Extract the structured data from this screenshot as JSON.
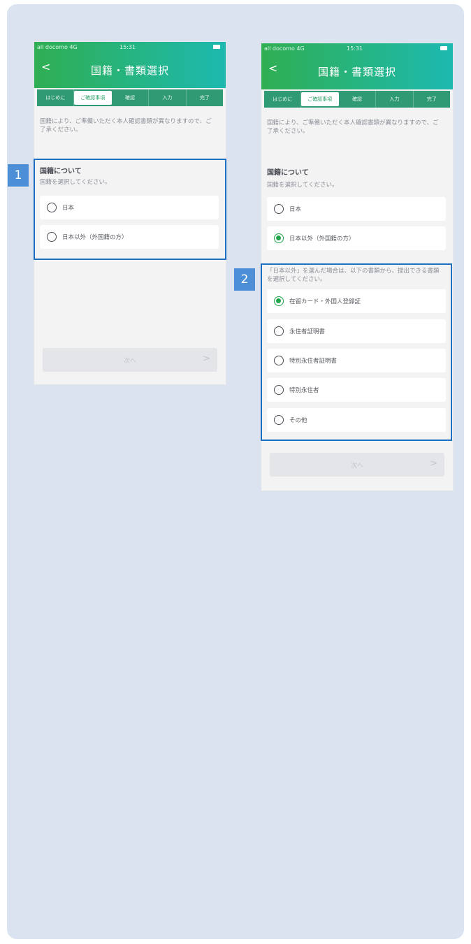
{
  "badges": [
    "1",
    "2"
  ],
  "screenA": {
    "status": {
      "carrier": "all docomo 4G",
      "time": "15:31"
    },
    "title": "国籍・書類選択",
    "back": "<",
    "steps": [
      "はじめに",
      "ご確認事項",
      "確認",
      "入力",
      "完了"
    ],
    "active_step": 1,
    "intro": "国籍により、ご準備いただく本人確認書類が異なりますので、ご了承ください。",
    "section_title": "国籍について",
    "section_sub": "国籍を選択してください。",
    "options": [
      "日本",
      "日本以外（外国籍の方）"
    ],
    "next": "次へ",
    "arrow": ">"
  },
  "screenB": {
    "status": {
      "carrier": "all docomo 4G",
      "time": "15:31"
    },
    "title": "国籍・書類選択",
    "back": "<",
    "steps": [
      "はじめに",
      "ご確認事項",
      "確認",
      "入力",
      "完了"
    ],
    "active_step": 1,
    "intro": "国籍により、ご準備いただく本人確認書類が異なりますので、ご了承ください。",
    "section_title": "国籍について",
    "section_sub": "国籍を選択してください。",
    "options": [
      "日本",
      "日本以外（外国籍の方）"
    ],
    "selected_option": 1,
    "note": "「日本以外」を選んだ場合は、以下の書類から、提出できる書類を選択してください。",
    "documents": [
      "在留カード・外国人登録証",
      "永住者証明書",
      "特別永住者証明書",
      "特別永住者",
      "その他"
    ],
    "selected_document": 0,
    "next": "次へ",
    "arrow": ">"
  },
  "colors": {
    "header_start": "#2fae52",
    "header_end": "#1db9b0",
    "highlight": "#1d6fc0",
    "badge": "#4d8fd6",
    "radio_selected": "#1fa64a"
  }
}
